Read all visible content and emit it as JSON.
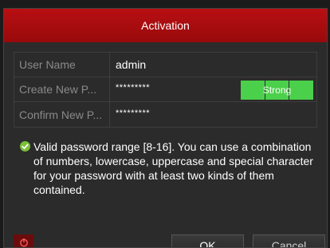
{
  "dialog": {
    "title": "Activation"
  },
  "form": {
    "username_label": "User Name",
    "username_value": "admin",
    "new_password_label": "Create New P...",
    "new_password_value": "*********",
    "password_strength": "Strong",
    "confirm_password_label": "Confirm New P...",
    "confirm_password_value": "*********"
  },
  "info": {
    "text": "Valid password range [8-16]. You can use a combination of numbers, lowercase, uppercase and special character for your password with at least two kinds of them contained.",
    "icon": "check-circle-icon"
  },
  "footer": {
    "power_icon": "power-icon",
    "ok_label": "OK",
    "cancel_label": "Cancel"
  },
  "colors": {
    "title_bar": "#a80d10",
    "strength_strong": "#4bd04b",
    "check_icon": "#7bbf3a",
    "power_button": "#6a0c0c"
  }
}
